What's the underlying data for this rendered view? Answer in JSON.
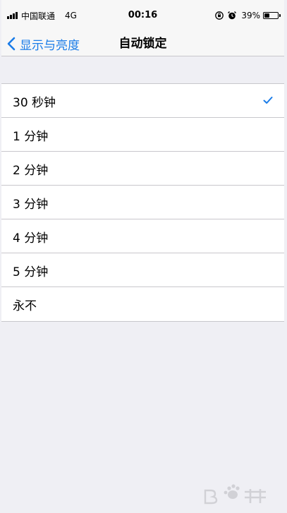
{
  "status_bar": {
    "carrier": "中国联通",
    "network": "4G",
    "time": "00:16",
    "battery_percent": "39%",
    "battery_level": 0.39
  },
  "nav": {
    "back_label": "显示与亮度",
    "title": "自动锁定"
  },
  "options": [
    {
      "label": "30 秒钟",
      "selected": true
    },
    {
      "label": "1 分钟",
      "selected": false
    },
    {
      "label": "2 分钟",
      "selected": false
    },
    {
      "label": "3 分钟",
      "selected": false
    },
    {
      "label": "4 分钟",
      "selected": false
    },
    {
      "label": "5 分钟",
      "selected": false
    },
    {
      "label": "永不",
      "selected": false
    }
  ],
  "icons": {
    "signal": "signal-bars-icon",
    "rotation_lock": "rotation-lock-icon",
    "alarm": "alarm-clock-icon",
    "battery": "battery-icon",
    "back": "chevron-left-icon",
    "check": "checkmark-icon"
  },
  "colors": {
    "accent": "#1a7ce8",
    "background": "#efeff4",
    "separator": "#c8c7cc"
  }
}
